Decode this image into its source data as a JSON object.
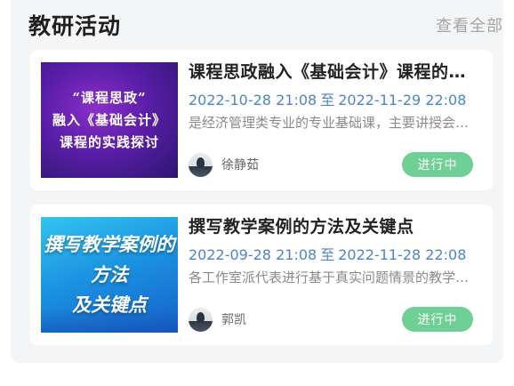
{
  "section": {
    "title": "教研活动",
    "view_all": "查看全部"
  },
  "activities": [
    {
      "thumb_lines": [
        "“课程思政”",
        "融入《基础会计》",
        "课程的实践探讨"
      ],
      "title": "课程思政融入《基础会计》课程的实践探讨",
      "start": "2022-10-28 21:08",
      "sep": "至",
      "end": "2022-11-29 22:08",
      "desc": "是经济管理类专业的专业基础课，主要讲授会计的基本理论、基本方法和基本技能",
      "author": "徐静茹",
      "status": "进行中"
    },
    {
      "thumb_lines": [
        "撰写教学案例的方法",
        "及关键点"
      ],
      "title": "撰写教学案例的方法及关键点",
      "start": "2022-09-28 21:08",
      "sep": "至",
      "end": "2022-11-28 22:08",
      "desc": "各工作室派代表进行基于真实问题情景的教学案例撰写分享",
      "author": "郭凯",
      "status": "进行中"
    }
  ],
  "colors": {
    "status_bg": "#6fd095",
    "date_text": "#4d84c9",
    "panel_bg": "#f4f5f7"
  }
}
